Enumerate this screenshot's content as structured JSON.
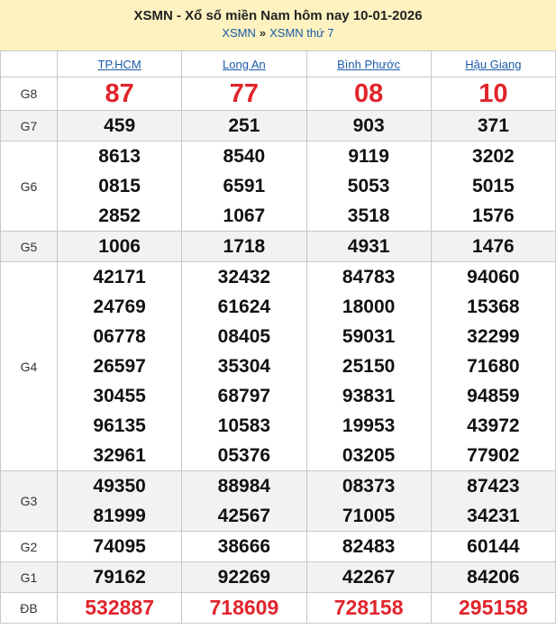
{
  "header": {
    "title": "XSMN - Xổ số miền Nam hôm nay 10-01-2026",
    "crumb1": "XSMN",
    "sep": "»",
    "crumb2": "XSMN thứ 7"
  },
  "provinces": [
    "TP.HCM",
    "Long An",
    "Bình Phước",
    "Hậu Giang"
  ],
  "prizes": [
    {
      "label": "G8",
      "values": [
        [
          "87"
        ],
        [
          "77"
        ],
        [
          "08"
        ],
        [
          "10"
        ]
      ]
    },
    {
      "label": "G7",
      "values": [
        [
          "459"
        ],
        [
          "251"
        ],
        [
          "903"
        ],
        [
          "371"
        ]
      ]
    },
    {
      "label": "G6",
      "values": [
        [
          "8613",
          "0815",
          "2852"
        ],
        [
          "8540",
          "6591",
          "1067"
        ],
        [
          "9119",
          "5053",
          "3518"
        ],
        [
          "3202",
          "5015",
          "1576"
        ]
      ]
    },
    {
      "label": "G5",
      "values": [
        [
          "1006"
        ],
        [
          "1718"
        ],
        [
          "4931"
        ],
        [
          "1476"
        ]
      ]
    },
    {
      "label": "G4",
      "values": [
        [
          "42171",
          "24769",
          "06778",
          "26597",
          "30455",
          "96135",
          "32961"
        ],
        [
          "32432",
          "61624",
          "08405",
          "35304",
          "68797",
          "10583",
          "05376"
        ],
        [
          "84783",
          "18000",
          "59031",
          "25150",
          "93831",
          "19953",
          "03205"
        ],
        [
          "94060",
          "15368",
          "32299",
          "71680",
          "94859",
          "43972",
          "77902"
        ]
      ]
    },
    {
      "label": "G3",
      "values": [
        [
          "49350",
          "81999"
        ],
        [
          "88984",
          "42567"
        ],
        [
          "08373",
          "71005"
        ],
        [
          "87423",
          "34231"
        ]
      ]
    },
    {
      "label": "G2",
      "values": [
        [
          "74095"
        ],
        [
          "38666"
        ],
        [
          "82483"
        ],
        [
          "60144"
        ]
      ]
    },
    {
      "label": "G1",
      "values": [
        [
          "79162"
        ],
        [
          "92269"
        ],
        [
          "42267"
        ],
        [
          "84206"
        ]
      ]
    },
    {
      "label": "ĐB",
      "values": [
        [
          "532887"
        ],
        [
          "718609"
        ],
        [
          "728158"
        ],
        [
          "295158"
        ]
      ]
    }
  ]
}
